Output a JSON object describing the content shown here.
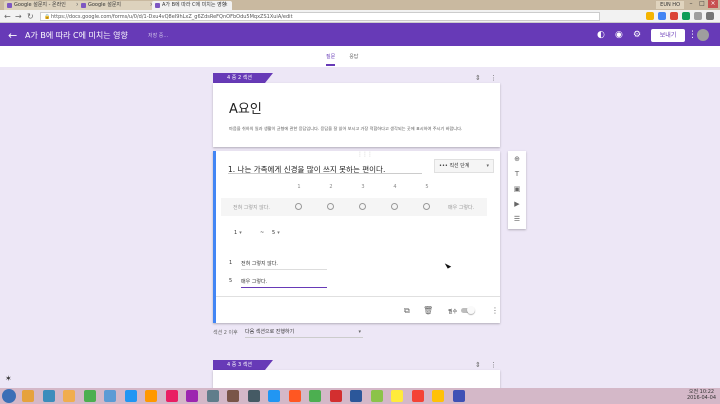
{
  "browser": {
    "tabs": [
      {
        "label": "Google 설문지 - 온라인"
      },
      {
        "label": "Google 설문지"
      },
      {
        "label": "A가 B에 따라 C에 미치는 영향"
      }
    ],
    "user_chip": "EUN HO",
    "url": "https://docs.google.com/forms/u/0/d/1-Dxu4vQ8eI9hLxZ_g6ZdsReFQnOFbOdu5MqxZS1XuiA/edit",
    "ext_colors": [
      "#f4b400",
      "#4285f4",
      "#db4437",
      "#0f9d58",
      "#9e9e9e",
      "#757575"
    ]
  },
  "header": {
    "title": "A가 B에 따라 C에 미치는 영향",
    "saved_status": "저장 중...",
    "send_label": "보내기",
    "accent": "#673ab7"
  },
  "tabs": {
    "questions": "질문",
    "responses": "응답"
  },
  "section2": {
    "tag": "4 중 2 섹션",
    "title": "A요인",
    "description": "마음을 쉬하의 일과 생활이 균형에 관한 응답입니다. 응답을 잘 읽어 보시고 가장 적합하다고 생각되는 곳에 표시하여 주시기 바랍니다."
  },
  "question": {
    "title": "1. 나는 가족에게 신경을 많이 쓰지  못하는 편이다.",
    "type_label": "직선 단계",
    "scale_numbers": [
      "1",
      "2",
      "3",
      "4",
      "5"
    ],
    "low_label": "전혀 그렇지 않다.",
    "high_label": "매우 그렇다.",
    "range_from": "1",
    "range_sep": "~",
    "range_to": "5",
    "label_rows": [
      {
        "num": "1",
        "value": "전혀 그렇지 않다."
      },
      {
        "num": "5",
        "value": "매우 그렇다."
      }
    ],
    "required_label": "필수"
  },
  "after_section": {
    "label": "섹션 2 이후",
    "value": "다음 섹션으로 진행하기"
  },
  "section3": {
    "tag": "4 중 3 섹션"
  },
  "taskbar": {
    "icon_colors": [
      "#e6a23c",
      "#3c8dbc",
      "#f0ad4e",
      "#4caf50",
      "#5b9bd5",
      "#2196f3",
      "#ff9800",
      "#e91e63",
      "#9c27b0",
      "#607d8b",
      "#795548",
      "#455a64",
      "#2196f3",
      "#ff5722",
      "#4caf50",
      "#d32f2f",
      "#2b579a",
      "#8bc34a",
      "#ffeb3b",
      "#f44336",
      "#ffc107",
      "#3f51b5"
    ],
    "time": "오전 10:22",
    "date": "2016-04-04"
  }
}
